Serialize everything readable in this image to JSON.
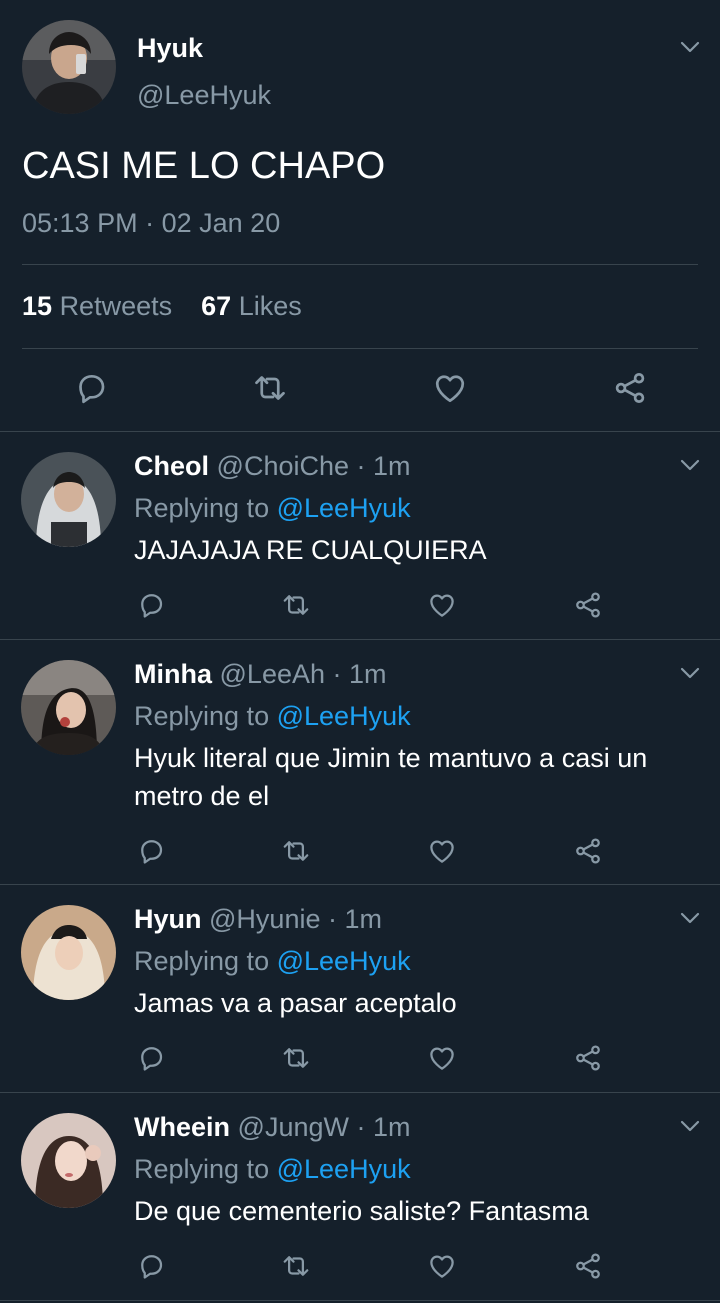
{
  "main_tweet": {
    "display_name": "Hyuk",
    "handle": "@LeeHyuk",
    "text": "CASI ME LO CHAPO",
    "time": "05:13 PM",
    "separator": "·",
    "date": "02 Jan 20",
    "retweets_count": "15",
    "retweets_label": "Retweets",
    "likes_count": "67",
    "likes_label": "Likes"
  },
  "replying_prefix": "Replying to",
  "icons": {
    "reply": "reply-icon",
    "retweet": "retweet-icon",
    "like": "like-icon",
    "share": "share-icon",
    "menu": "chevron-down-icon"
  },
  "colors": {
    "background": "#15202b",
    "muted": "#8899a6",
    "link": "#1da1f2",
    "divider": "#38444d"
  },
  "replies": [
    {
      "display_name": "Cheol",
      "handle": "@ChoiChe",
      "separator": "·",
      "time": "1m",
      "replying_to": "@LeeHyuk",
      "text": "JAJAJAJA RE CUALQUIERA"
    },
    {
      "display_name": "Minha",
      "handle": "@LeeAh",
      "separator": "·",
      "time": "1m",
      "replying_to": "@LeeHyuk",
      "text_line1": "Hyuk literal que Jimin te mantuvo a casi un",
      "text_line2": "metro de el"
    },
    {
      "display_name": "Hyun",
      "handle": "@Hyunie",
      "separator": "·",
      "time": "1m",
      "replying_to": "@LeeHyuk",
      "text": "Jamas va a pasar aceptalo"
    },
    {
      "display_name": "Wheein",
      "handle": "@JungW",
      "separator": "·",
      "time": "1m",
      "replying_to": "@LeeHyuk",
      "text": "De que cementerio saliste? Fantasma"
    }
  ]
}
